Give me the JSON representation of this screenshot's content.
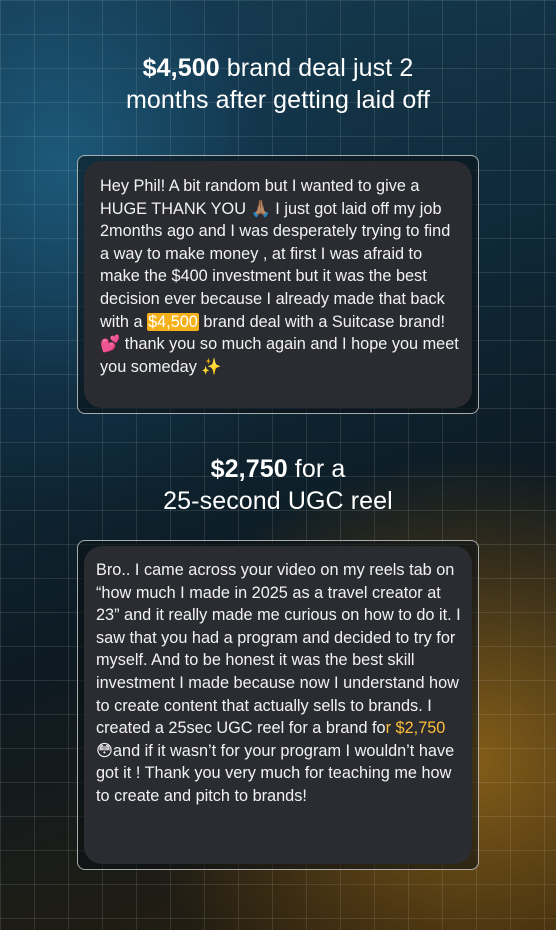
{
  "section1": {
    "headline_amount": "$4,500",
    "headline_rest_line1": " brand deal just 2",
    "headline_line2": "months after getting laid off",
    "message": {
      "part1": "Hey Phil! A bit random but I wanted to give a HUGE THANK YOU ",
      "emoji1": "🙏🏽",
      "part2": " I just got laid off my job 2months ago and I was desperately trying to find a way to make money , at first I was afraid to make the $400 investment but it was the best decision ever because I already made that back with a ",
      "highlight": "$4,500",
      "part3": " brand deal with a Suitcase brand! ",
      "emoji2": "💕",
      "part4": " thank you so much again and I hope you meet you someday ",
      "emoji3": "✨"
    }
  },
  "section2": {
    "headline_amount": "$2,750",
    "headline_rest_line1": " for a",
    "headline_line2": "25-second UGC reel",
    "message": {
      "part1": "Bro.. I came across your video on my reels tab on “how much I made in 2025 as a travel creator at 23” and it really made me curious on how to do it. I saw that you had a program and decided to try for myself. And to be honest it was the best skill investment I made because now I understand how to create content that actually sells to brands. I created a 25sec UGC reel for a brand fo",
      "highlight": "r $2,750",
      "part2": " ",
      "emoji1": "😳",
      "part3": "and if it wasn’t for your program I wouldn’t have got it ! Thank you very much for teaching me how to create and pitch to brands!"
    }
  },
  "colors": {
    "highlight_bg": "#f5b01a",
    "highlight_text": "#ffbf3a",
    "bubble_bg": "#2a2c31",
    "card_border": "#dcdcdc"
  }
}
